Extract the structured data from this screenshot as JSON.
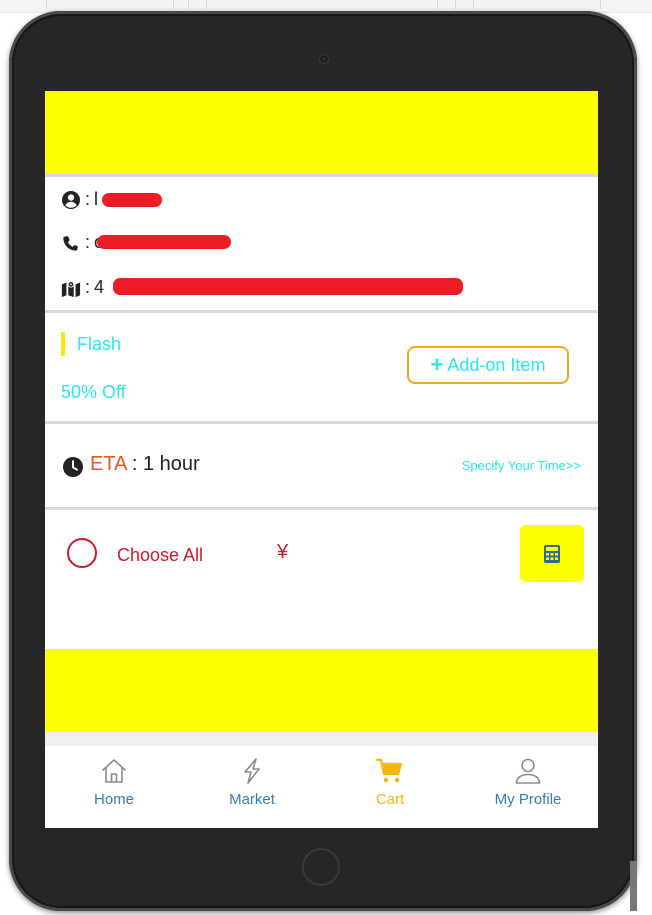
{
  "address_card": {
    "name_colon": ":",
    "name_value": "l",
    "phone_colon": ":",
    "phone_value": "c",
    "address_colon": ":",
    "address_value": "4"
  },
  "promo": {
    "title": "Flash",
    "discount": "50% Off",
    "addon_button": "Add-on Item"
  },
  "delivery": {
    "eta_label": "ETA",
    "eta_value": ": 1 hour",
    "specify_link": "Specify Your Time>>"
  },
  "cart_actions": {
    "choose_all": "Choose All",
    "currency_symbol": "¥"
  },
  "nav": {
    "items": [
      {
        "label": "Home",
        "icon": "home-icon",
        "active": false
      },
      {
        "label": "Market",
        "icon": "lightning-icon",
        "active": false
      },
      {
        "label": "Cart",
        "icon": "cart-icon",
        "active": true
      },
      {
        "label": "My Profile",
        "icon": "user-icon",
        "active": false
      }
    ]
  },
  "colors": {
    "banner_yellow": "#ffff00",
    "accent_cyan": "#2ae5ee",
    "accent_red": "#d0182d",
    "eta_orange": "#e8571e",
    "addon_border": "#f4a62a",
    "nav_blue": "#3879b9",
    "nav_active": "#f5b50a",
    "redaction": "#ee1c25"
  }
}
